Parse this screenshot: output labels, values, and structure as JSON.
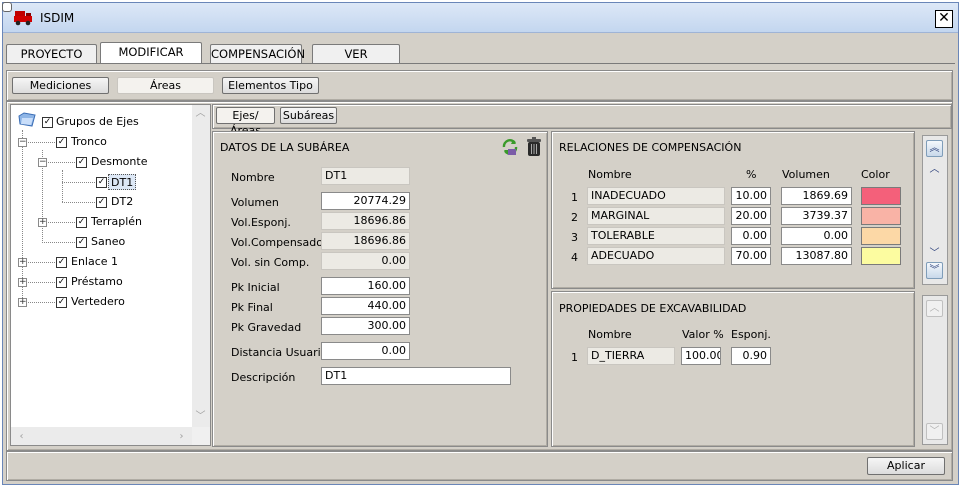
{
  "window": {
    "title": "ISDIM",
    "close_label": "✕"
  },
  "main_tabs": [
    "PROYECTO",
    "MODIFICAR",
    "COMPENSACIÓN",
    "VER"
  ],
  "sub_tabs": [
    "Mediciones",
    "Áreas",
    "Elementos Tipo"
  ],
  "area_tabs": [
    "Ejes/Áreas",
    "Subáreas"
  ],
  "tree": {
    "root": "Grupos de Ejes",
    "nodes": [
      "Tronco",
      "Desmonte",
      "DT1",
      "DT2",
      "Terraplén",
      "Saneo",
      "Enlace 1",
      "Préstamo",
      "Vertedero"
    ]
  },
  "datos": {
    "title": "DATOS DE LA SUBÁREA",
    "labels": {
      "nombre": "Nombre",
      "volumen": "Volumen",
      "vol_esponj": "Vol.Esponj.",
      "vol_compensado": "Vol.Compensado",
      "vol_sin_comp": "Vol. sin Comp.",
      "pk_inicial": "Pk Inicial",
      "pk_final": "Pk Final",
      "pk_gravedad": "Pk Gravedad",
      "distancia_usuario": "Distancia Usuario",
      "descripcion": "Descripción"
    },
    "values": {
      "nombre": "DT1",
      "volumen": "20774.29",
      "vol_esponj": "18696.86",
      "vol_compensado": "18696.86",
      "vol_sin_comp": "0.00",
      "pk_inicial": "160.00",
      "pk_final": "440.00",
      "pk_gravedad": "300.00",
      "distancia_usuario": "0.00",
      "descripcion": "DT1"
    }
  },
  "relaciones": {
    "title": "RELACIONES DE COMPENSACIÓN",
    "headers": {
      "nombre": "Nombre",
      "pct": "%",
      "volumen": "Volumen",
      "color": "Color"
    },
    "rows": [
      {
        "n": "1",
        "nombre": "INADECUADO",
        "pct": "10.00",
        "volumen": "1869.69",
        "color": "#f4607a"
      },
      {
        "n": "2",
        "nombre": "MARGINAL",
        "pct": "20.00",
        "volumen": "3739.37",
        "color": "#f9b3a6"
      },
      {
        "n": "3",
        "nombre": "TOLERABLE",
        "pct": "0.00",
        "volumen": "0.00",
        "color": "#fcd8a6"
      },
      {
        "n": "4",
        "nombre": "ADECUADO",
        "pct": "70.00",
        "volumen": "13087.80",
        "color": "#fcfca0"
      }
    ]
  },
  "propiedades": {
    "title": "PROPIEDADES DE EXCAVABILIDAD",
    "headers": {
      "nombre": "Nombre",
      "valor": "Valor %",
      "esponj": "Esponj."
    },
    "rows": [
      {
        "n": "1",
        "nombre": "D_TIERRA",
        "valor": "100.00",
        "esponj": "0.90"
      }
    ]
  },
  "footer": {
    "apply_label": "Aplicar"
  }
}
